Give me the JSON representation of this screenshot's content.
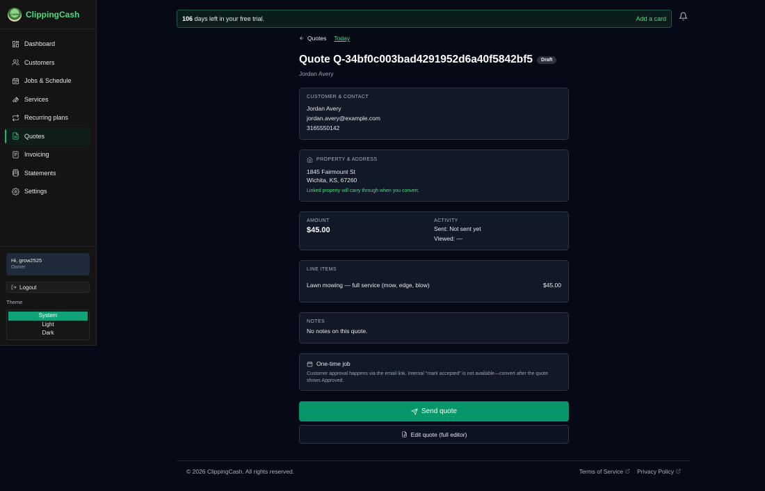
{
  "brand": {
    "name": "ClippingCash",
    "logo_text": "CASH"
  },
  "sidebar": {
    "items": [
      {
        "label": "Dashboard",
        "icon": "dashboard-icon"
      },
      {
        "label": "Customers",
        "icon": "users-icon"
      },
      {
        "label": "Jobs & Schedule",
        "icon": "calendar-icon"
      },
      {
        "label": "Services",
        "icon": "wrench-icon"
      },
      {
        "label": "Recurring plans",
        "icon": "repeat-icon"
      },
      {
        "label": "Quotes",
        "icon": "document-icon",
        "active": true
      },
      {
        "label": "Invoicing",
        "icon": "invoice-icon"
      },
      {
        "label": "Statements",
        "icon": "statements-icon"
      },
      {
        "label": "Settings",
        "icon": "gear-icon"
      }
    ],
    "user": {
      "greeting": "Hi, grow2525",
      "role": "Owner"
    },
    "logout_label": "Logout",
    "theme": {
      "label": "Theme",
      "options": [
        "System",
        "Light",
        "Dark"
      ],
      "selected": "System"
    }
  },
  "trial": {
    "days": "106",
    "text": " days left in your free trial.",
    "cta": "Add a card"
  },
  "breadcrumb": {
    "back_label": "Quotes",
    "today_label": "Today"
  },
  "quote": {
    "title": "Quote Q-34bf0c003bad4291952d6a40f5842bf5",
    "status": "Draft",
    "customer_name": "Jordan Avery"
  },
  "contact": {
    "heading": "Customer & Contact",
    "name": "Jordan Avery",
    "email": "jordan.avery@example.com",
    "phone": "3165550142"
  },
  "property": {
    "heading": "Property & Address",
    "street": "1845 Fairmount St",
    "city_line": "Wichita, KS, 67260",
    "note": "Linked property will carry through when you convert."
  },
  "summary": {
    "amount_label": "Amount",
    "amount": "$45.00",
    "activity_label": "Activity",
    "sent": "Sent: Not sent yet",
    "viewed": "Viewed: —"
  },
  "line_items": {
    "heading": "Line Items",
    "items": [
      {
        "description": "Lawn mowing — full service (mow, edge, blow)",
        "amount": "$45.00"
      }
    ]
  },
  "notes": {
    "heading": "Notes",
    "text": "No notes on this quote."
  },
  "job": {
    "title": "One-time job",
    "description": "Customer approval happens via the email link. Internal \"mark accepted\" is not available—convert after the quote shows Approved."
  },
  "actions": {
    "send_label": "Send quote",
    "edit_label": "Edit quote (full editor)"
  },
  "footer": {
    "copyright": "© 2026 ClippingCash. All rights reserved.",
    "terms": "Terms of Service",
    "privacy": "Privacy Policy"
  },
  "colors": {
    "accent": "#10b981",
    "brand": "#4ade80",
    "background": "#060a17"
  }
}
